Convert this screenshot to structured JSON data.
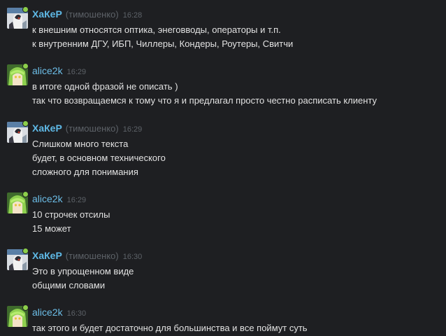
{
  "messages": [
    {
      "author": "ХаКеР",
      "nick": "(тимошенко)",
      "time": "16:28",
      "avatar": "haker-avatar",
      "lines": [
        "к внешним относятся оптика, энеговводы, операторы и т.п.",
        "к внутренним ДГУ, ИБП, Чиллеры, Кондеры, Роутеры, Свитчи"
      ]
    },
    {
      "author": "alice2k",
      "time": "16:29",
      "avatar": "alice2k-avatar",
      "lines": [
        "в итоге одной фразой не описать )",
        "так что возвращаемся к тому что я и предлагал просто честно расписать клиенту"
      ]
    },
    {
      "author": "ХаКеР",
      "nick": "(тимошенко)",
      "time": "16:29",
      "avatar": "haker-avatar",
      "lines": [
        "Слишком много текста",
        "будет, в основном технического",
        "сложного для понимания"
      ]
    },
    {
      "author": "alice2k",
      "time": "16:29",
      "avatar": "alice2k-avatar",
      "lines": [
        "10 строчек отсилы",
        "15 может"
      ]
    },
    {
      "author": "ХаКеР",
      "nick": "(тимошенко)",
      "time": "16:30",
      "avatar": "haker-avatar",
      "lines": [
        "Это в упрощенном виде",
        "общими словами"
      ]
    },
    {
      "author": "alice2k",
      "time": "16:30",
      "avatar": "alice2k-avatar",
      "lines": [
        "так этого и будет достаточно для большинства и все поймут суть"
      ]
    }
  ],
  "colors": {
    "background": "#1e1f22",
    "author": "#5fb9e6",
    "meta": "#5d6268",
    "text": "#e2e2e2",
    "online": "#8ccf4a"
  }
}
